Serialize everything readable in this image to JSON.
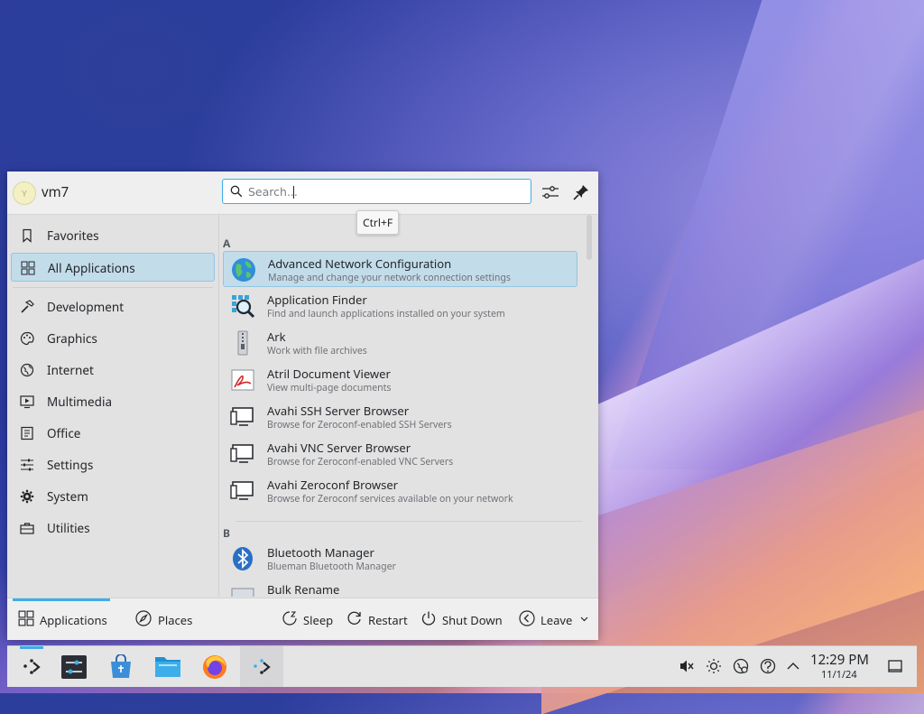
{
  "user": {
    "name": "vm7",
    "avatar_letter": "Y"
  },
  "search": {
    "placeholder": "Search...",
    "tooltip": "Ctrl+F"
  },
  "sidebar": {
    "items": [
      {
        "label": "Favorites",
        "icon": "bookmark-icon"
      },
      {
        "label": "All Applications",
        "icon": "grid-icon",
        "active": true
      },
      {
        "label": "Development",
        "icon": "hammer-icon"
      },
      {
        "label": "Graphics",
        "icon": "palette-icon"
      },
      {
        "label": "Internet",
        "icon": "globe-icon"
      },
      {
        "label": "Multimedia",
        "icon": "multimedia-icon"
      },
      {
        "label": "Office",
        "icon": "document-icon"
      },
      {
        "label": "Settings",
        "icon": "sliders-icon"
      },
      {
        "label": "System",
        "icon": "gear-icon"
      },
      {
        "label": "Utilities",
        "icon": "toolbox-icon"
      }
    ]
  },
  "apps": {
    "section_a": "A",
    "section_b": "B",
    "items": [
      {
        "name": "Advanced Network Configuration",
        "desc": "Manage and change your network connection settings",
        "icon": "network-globe-icon",
        "active": true
      },
      {
        "name": "Application Finder",
        "desc": "Find and launch applications installed on your system",
        "icon": "app-finder-icon"
      },
      {
        "name": "Ark",
        "desc": "Work with file archives",
        "icon": "archive-icon"
      },
      {
        "name": "Atril Document Viewer",
        "desc": "View multi-page documents",
        "icon": "pdf-viewer-icon"
      },
      {
        "name": "Avahi SSH Server Browser",
        "desc": "Browse for Zeroconf-enabled SSH Servers",
        "icon": "computer-icon"
      },
      {
        "name": "Avahi VNC Server Browser",
        "desc": "Browse for Zeroconf-enabled VNC Servers",
        "icon": "computer-icon"
      },
      {
        "name": "Avahi Zeroconf Browser",
        "desc": "Browse for Zeroconf services available on your network",
        "icon": "computer-icon"
      },
      {
        "name": "Bluetooth Manager",
        "desc": "Blueman Bluetooth Manager",
        "icon": "bluetooth-icon"
      },
      {
        "name": "Bulk Rename",
        "desc": "",
        "icon": "rename-icon"
      }
    ]
  },
  "footer": {
    "applications": "Applications",
    "places": "Places",
    "sleep": "Sleep",
    "restart": "Restart",
    "shutdown": "Shut Down",
    "leave": "Leave"
  },
  "taskbar": {
    "time": "12:29 PM",
    "date": "11/1/24"
  },
  "colors": {
    "accent": "#3daee9",
    "highlight": "#c3dcea"
  }
}
